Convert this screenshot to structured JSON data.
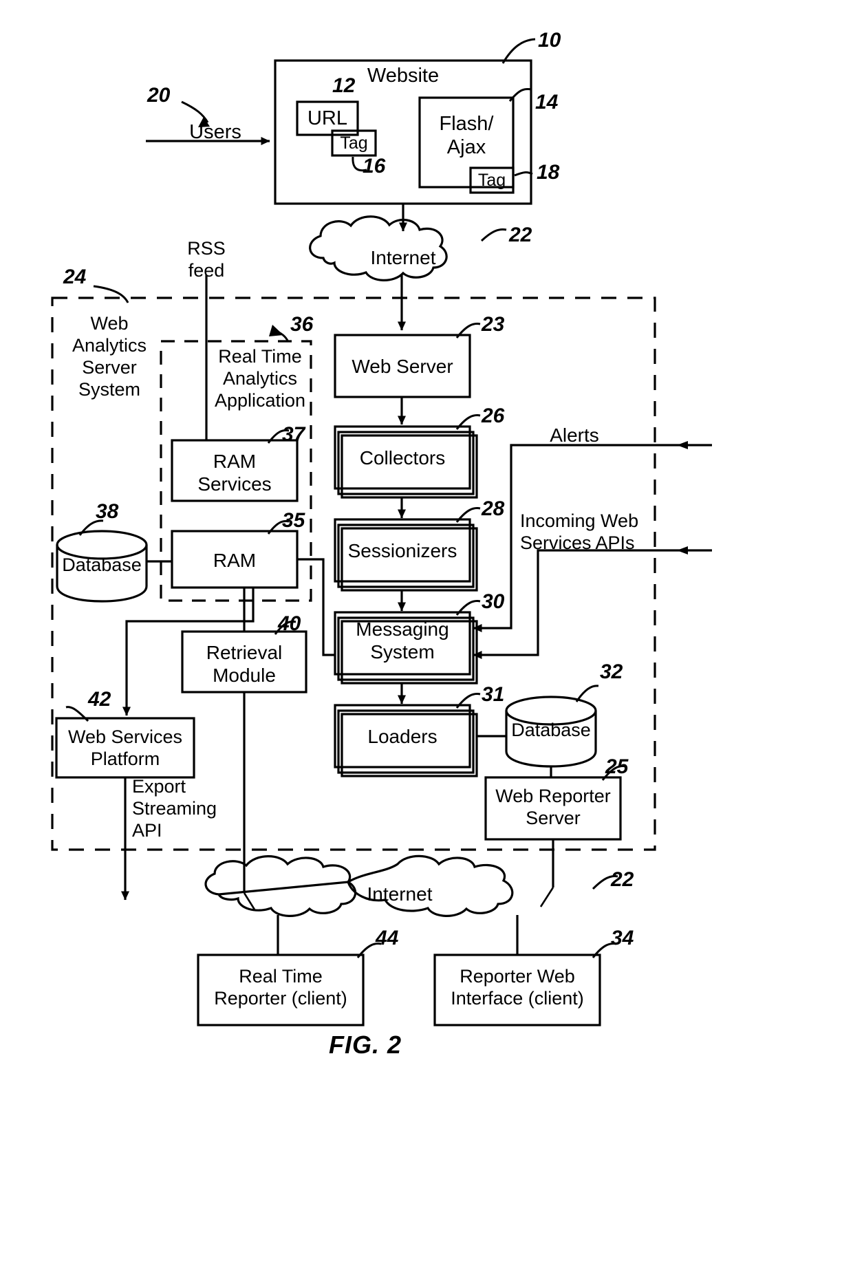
{
  "figure": {
    "caption": "FIG. 2"
  },
  "blocks": {
    "website": {
      "label": "Website",
      "ref": "10"
    },
    "url": {
      "label": "URL",
      "ref": "12"
    },
    "url_tag": {
      "label": "Tag",
      "ref": "16"
    },
    "flash_ajax": {
      "label": "Flash/\nAjax",
      "line1": "Flash/",
      "line2": "Ajax",
      "ref": "14"
    },
    "flash_tag": {
      "label": "Tag",
      "ref": "18"
    },
    "users": {
      "label": "Users",
      "ref": "20"
    },
    "internet_top": {
      "label": "Internet",
      "ref": "22"
    },
    "internet_bottom": {
      "label": "Internet",
      "ref": "22"
    },
    "was_system": {
      "line1": "Web",
      "line2": "Analytics",
      "line3": "Server",
      "line4": "System",
      "ref": "24"
    },
    "rss_feed": {
      "line1": "RSS",
      "line2": "feed"
    },
    "rta_app": {
      "line1": "Real Time",
      "line2": "Analytics",
      "line3": "Application",
      "ref": "36"
    },
    "ram_services": {
      "line1": "RAM",
      "line2": "Services",
      "ref": "37"
    },
    "ram": {
      "label": "RAM",
      "ref": "35"
    },
    "database_38": {
      "label": "Database",
      "ref": "38"
    },
    "retrieval_module": {
      "line1": "Retrieval",
      "line2": "Module",
      "ref": "40"
    },
    "web_services_platform": {
      "line1": "Web Services",
      "line2": "Platform",
      "ref": "42"
    },
    "export_streaming_api": {
      "line1": "Export",
      "line2": "Streaming",
      "line3": "API"
    },
    "web_server": {
      "label": "Web Server",
      "ref": "23"
    },
    "collectors": {
      "label": "Collectors",
      "ref": "26"
    },
    "sessionizers": {
      "label": "Sessionizers",
      "ref": "28"
    },
    "messaging_system": {
      "line1": "Messaging",
      "line2": "System",
      "ref": "30"
    },
    "loaders": {
      "label": "Loaders",
      "ref": "31"
    },
    "database_32": {
      "label": "Database",
      "ref": "32"
    },
    "web_reporter_server": {
      "line1": "Web Reporter",
      "line2": "Server",
      "ref": "25"
    },
    "alerts": {
      "label": "Alerts"
    },
    "incoming_apis": {
      "line1": "Incoming Web",
      "line2": "Services APIs"
    },
    "real_time_reporter": {
      "line1": "Real Time",
      "line2": "Reporter (client)",
      "ref": "44"
    },
    "reporter_web_interface": {
      "line1": "Reporter Web",
      "line2": "Interface (client)",
      "ref": "34"
    }
  },
  "colors": {
    "stroke": "#000000",
    "background": "#ffffff"
  }
}
